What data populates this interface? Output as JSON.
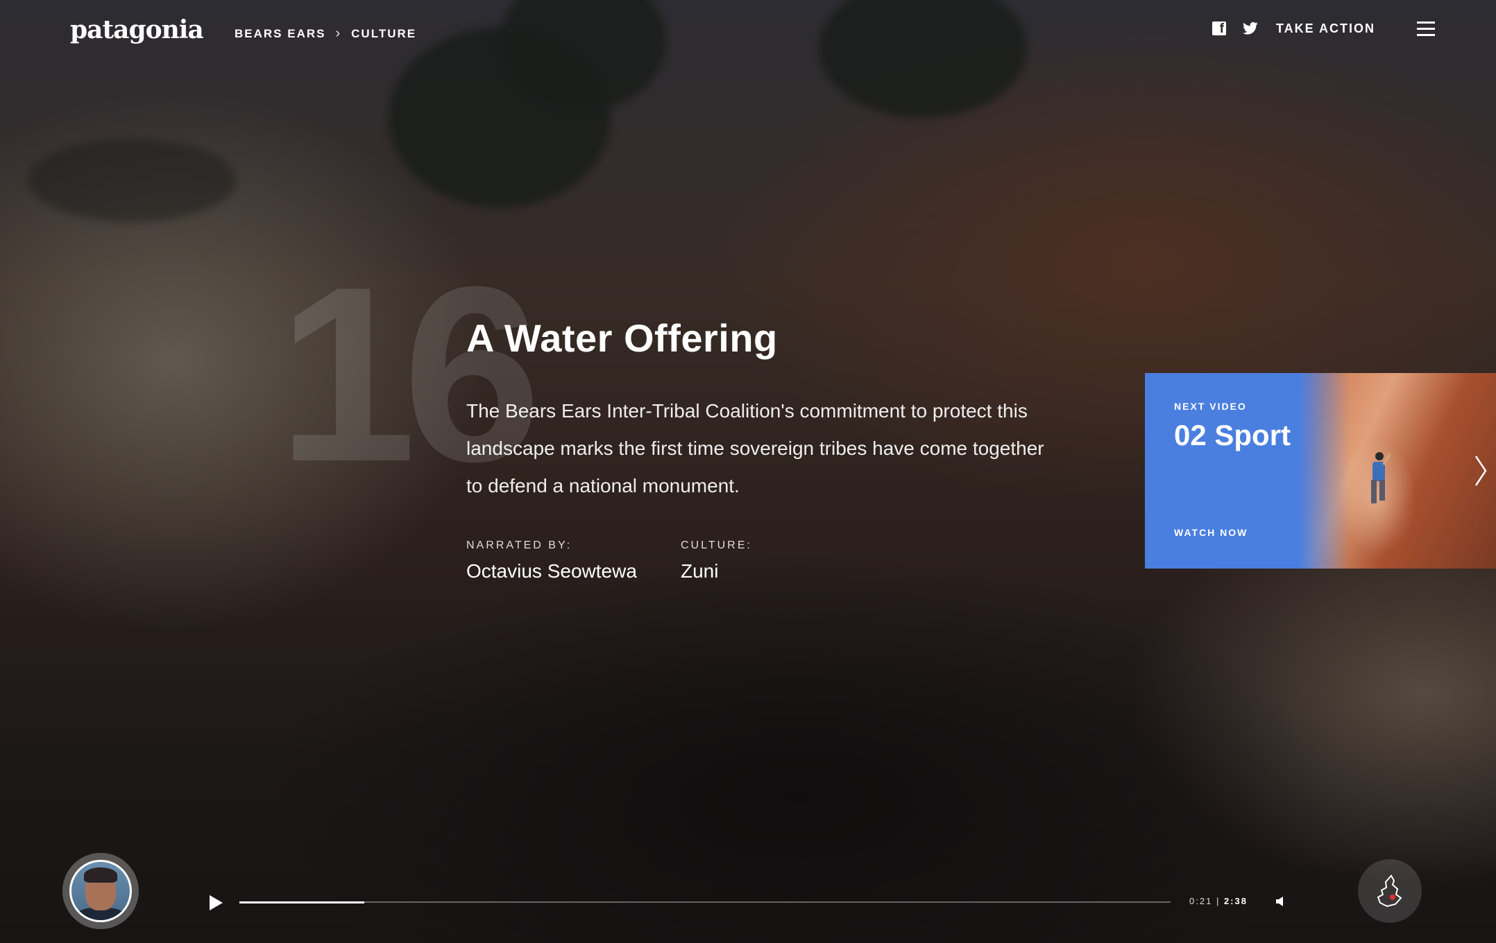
{
  "header": {
    "logo": "patagonia",
    "breadcrumb": [
      "BEARS EARS",
      "CULTURE"
    ],
    "facebook_icon": "facebook-icon",
    "twitter_icon": "twitter-icon",
    "take_action": "TAKE ACTION",
    "menu_icon": "hamburger-menu-icon"
  },
  "hero": {
    "background_number": "16",
    "title": "A Water Offering",
    "description": "The Bears Ears Inter-Tribal Coalition's commitment to protect this landscape marks the first time sovereign tribes have come together to defend a national monument.",
    "narrated_by_label": "NARRATED BY:",
    "narrator": "Octavius Seowtewa",
    "culture_label": "CULTURE:",
    "culture": "Zuni"
  },
  "next_video": {
    "label": "NEXT VIDEO",
    "title": "02 Sport",
    "cta": "WATCH NOW",
    "accent_color": "#4a7fe0"
  },
  "player": {
    "current_time": "0:21",
    "separator": "|",
    "duration": "2:38",
    "progress_fraction": 0.134,
    "play_icon": "play-icon",
    "volume_icon": "volume-icon",
    "map_icon": "map-icon"
  }
}
